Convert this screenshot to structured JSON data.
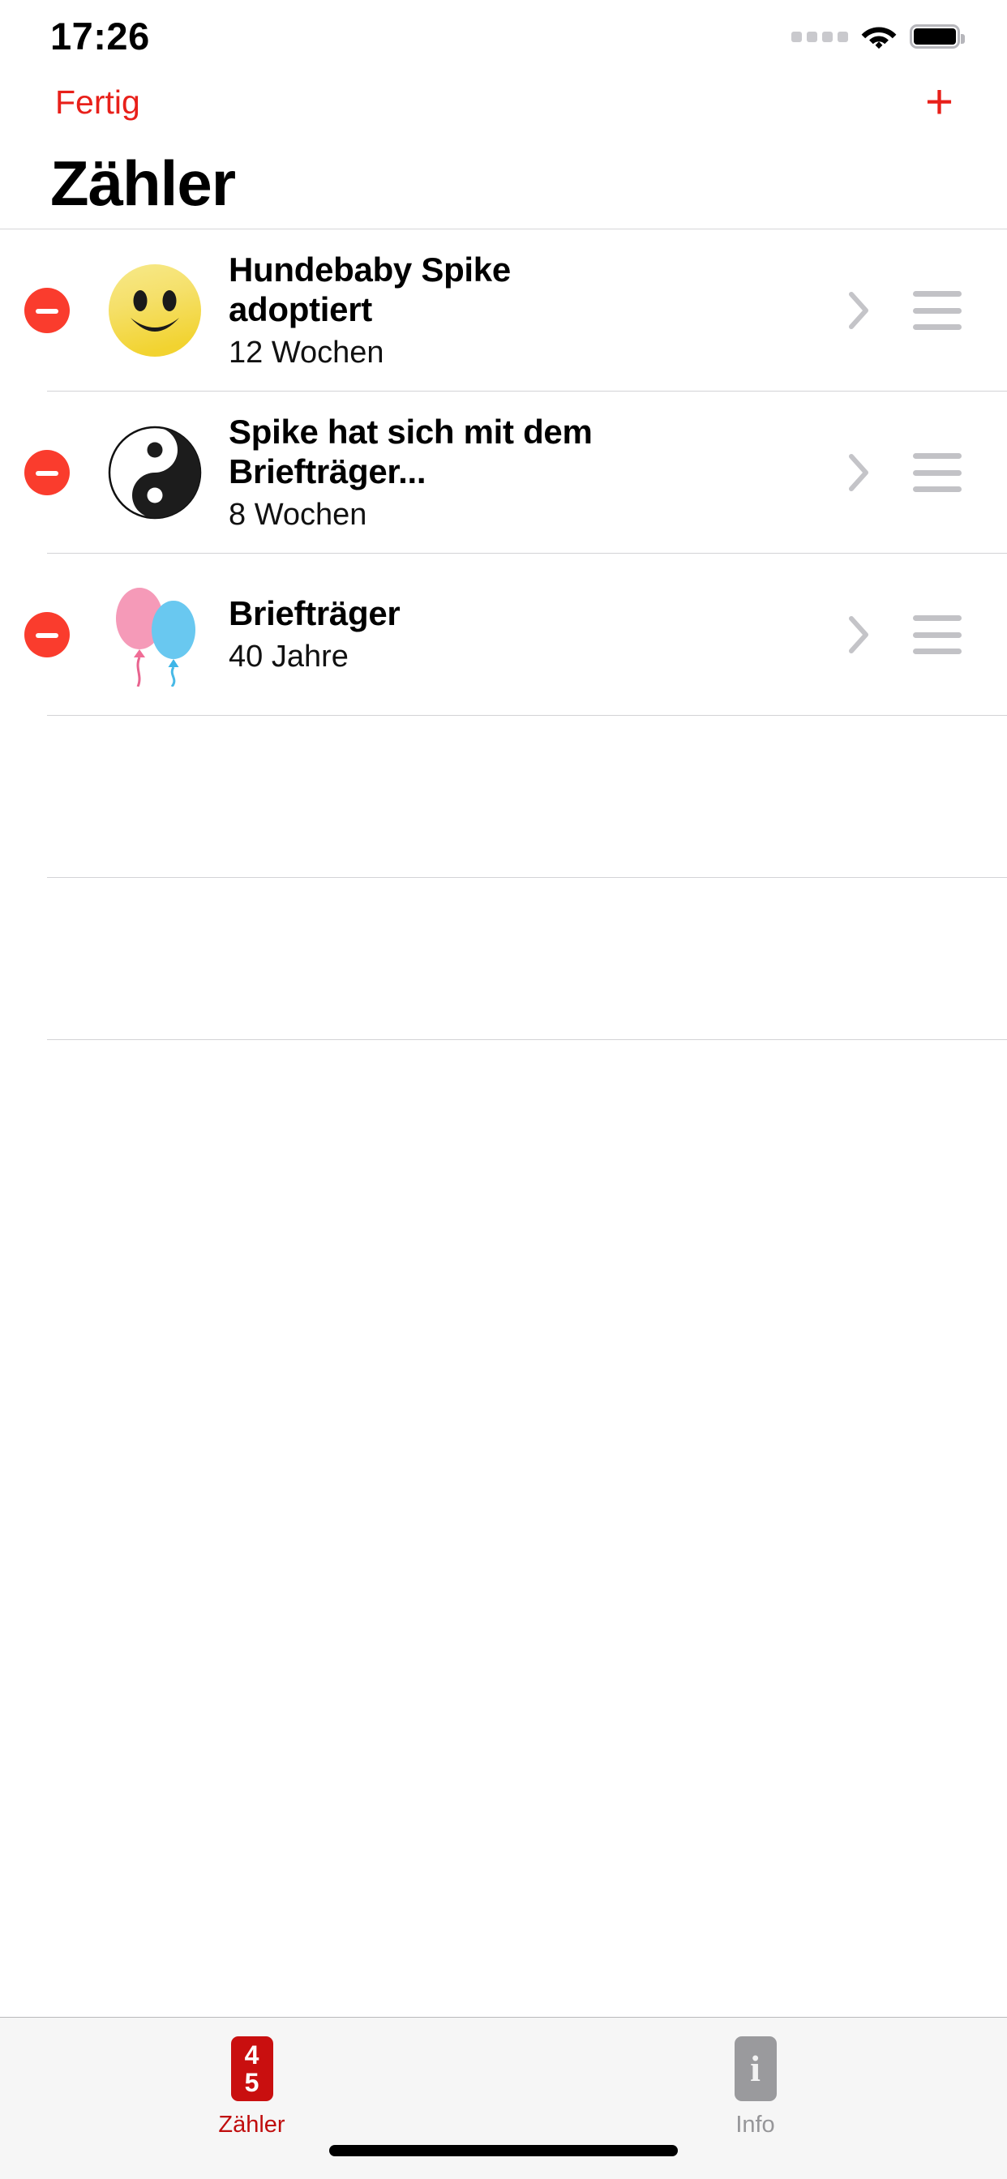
{
  "status_bar": {
    "time": "17:26",
    "signal_icon": "cellular-dots-icon",
    "wifi_icon": "wifi-icon",
    "battery_icon": "battery-full-icon"
  },
  "nav_bar": {
    "done_label": "Fertig",
    "add_label": "+"
  },
  "page_title": "Zähler",
  "list": {
    "rows": [
      {
        "emoji": "smiling-face-emoji",
        "title": "Hundebaby Spike adoptiert",
        "subtitle": "12 Wochen",
        "delete_icon": "minus-circle-icon",
        "disclosure_icon": "chevron-right-icon",
        "reorder_icon": "reorder-handle-icon"
      },
      {
        "emoji": "yin-yang-emoji",
        "title": "Spike hat sich mit dem Briefträger...",
        "subtitle": "8 Wochen",
        "delete_icon": "minus-circle-icon",
        "disclosure_icon": "chevron-right-icon",
        "reorder_icon": "reorder-handle-icon"
      },
      {
        "emoji": "balloons-emoji",
        "title": "Briefträger",
        "subtitle": "40 Jahre",
        "delete_icon": "minus-circle-icon",
        "disclosure_icon": "chevron-right-icon",
        "reorder_icon": "reorder-handle-icon"
      }
    ]
  },
  "tab_bar": {
    "tabs": [
      {
        "label": "Zähler",
        "icon": "calendar-counter-icon",
        "icon_top": "4",
        "icon_bottom": "5",
        "active": true
      },
      {
        "label": "Info",
        "icon": "info-icon",
        "icon_glyph": "i",
        "active": false
      }
    ]
  },
  "colors": {
    "accent_red": "#e8201a",
    "delete_red": "#fa3c2d",
    "tab_active_red": "#c00d0d",
    "tab_inactive_gray": "#969699",
    "separator": "#d3d3d6",
    "tabbar_bg": "#f6f6f6"
  }
}
